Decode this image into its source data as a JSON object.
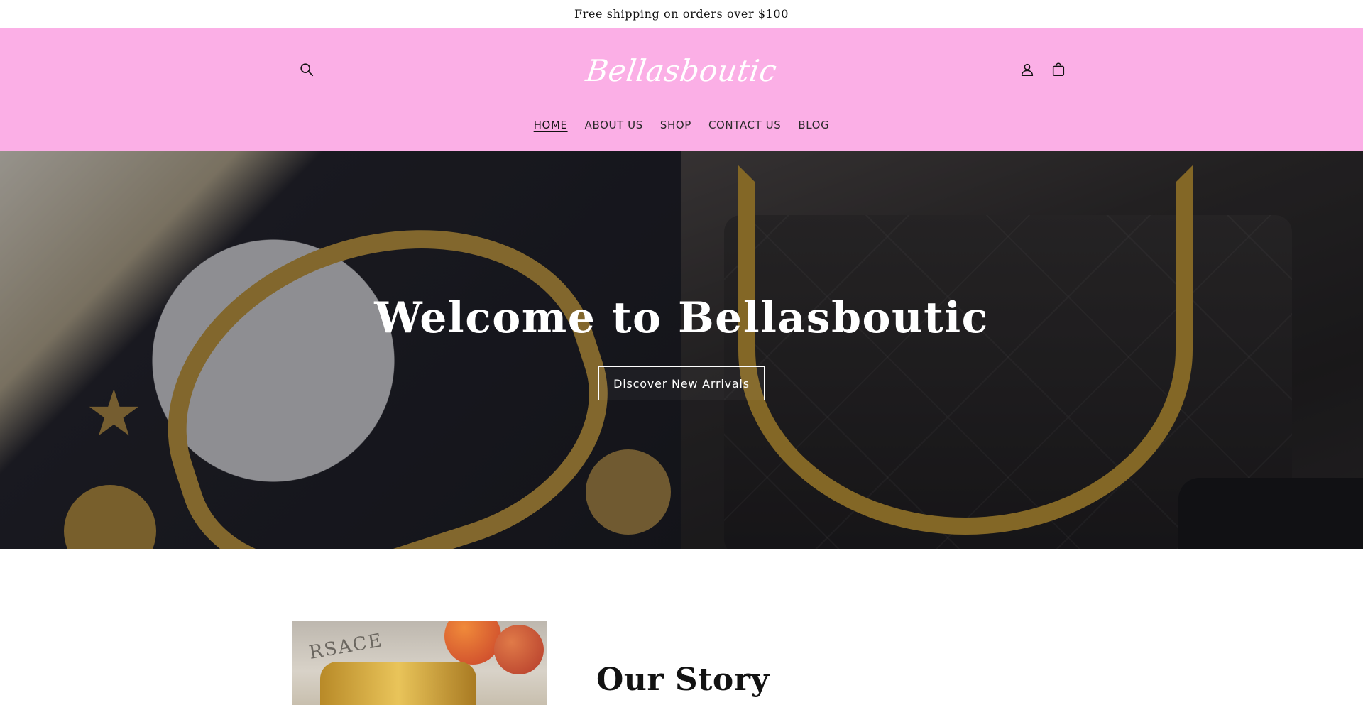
{
  "announcement": {
    "text": "Free shipping on orders over $100"
  },
  "header": {
    "logo_text": "Bellasboutic",
    "background_color": "#fbafe6",
    "icons": {
      "search": "search-icon",
      "account": "account-icon",
      "cart": "cart-icon"
    }
  },
  "nav": {
    "items": [
      {
        "label": "HOME",
        "active": true
      },
      {
        "label": "ABOUT US",
        "active": false
      },
      {
        "label": "SHOP",
        "active": false
      },
      {
        "label": "CONTACT US",
        "active": false
      },
      {
        "label": "BLOG",
        "active": false
      }
    ]
  },
  "hero": {
    "title": "Welcome to Bellasboutic",
    "button_label": "Discover New Arrivals"
  },
  "story": {
    "title": "Our Story",
    "image_brand_text": "RSACE"
  }
}
